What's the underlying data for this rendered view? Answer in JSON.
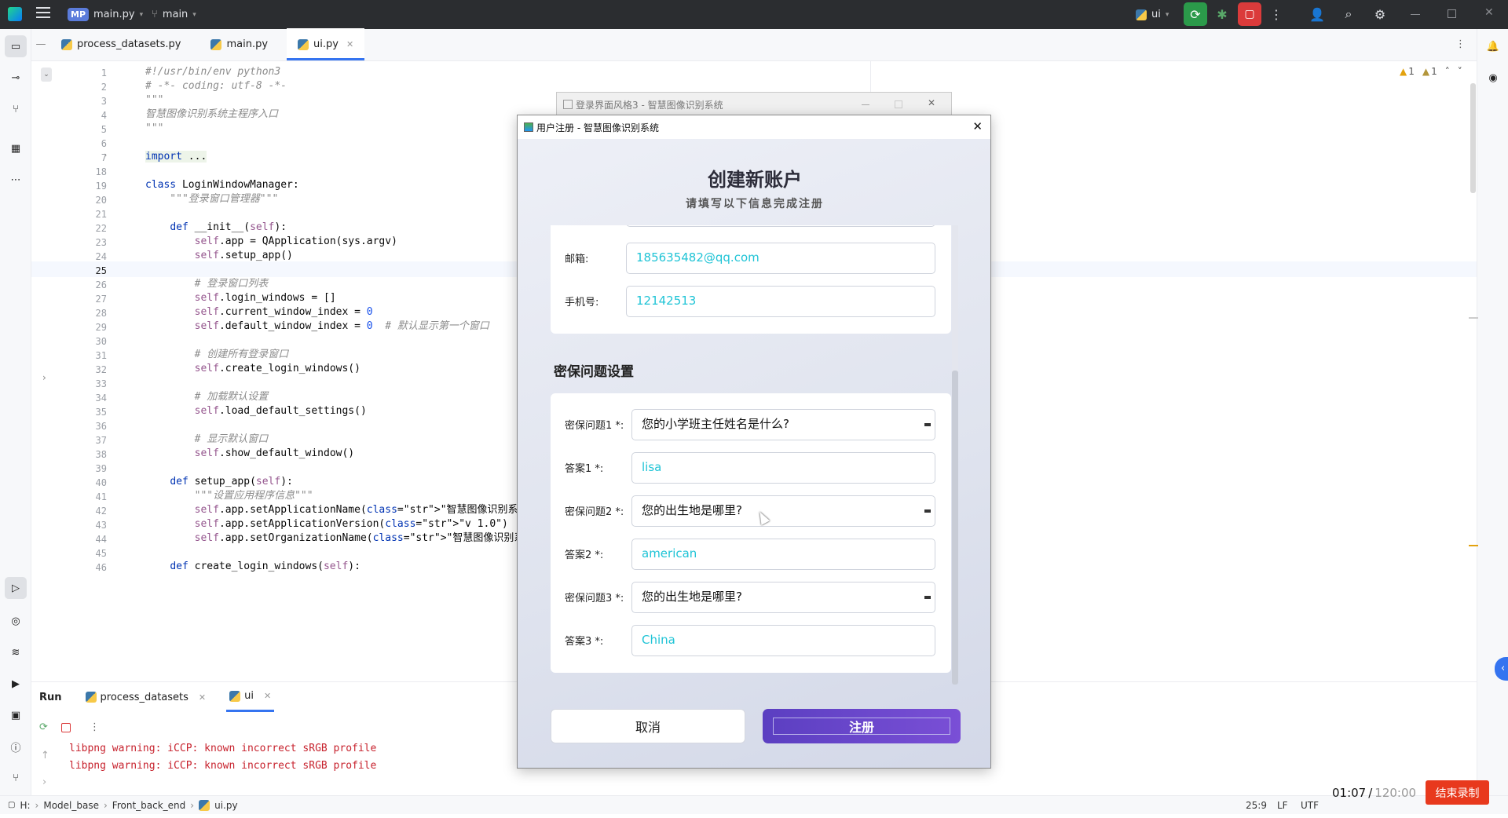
{
  "topbar": {
    "project_badge": "MP",
    "project": "main.py",
    "branch": "main",
    "run_config": "ui"
  },
  "tabs": [
    {
      "label": "process_datasets.py"
    },
    {
      "label": "main.py"
    },
    {
      "label": "ui.py"
    }
  ],
  "editor": {
    "inspections": {
      "warnings": "1",
      "weak_warnings": "1"
    },
    "line_numbers": [
      "1",
      "2",
      "3",
      "4",
      "5",
      "6",
      "7",
      "18",
      "19",
      "20",
      "21",
      "22",
      "23",
      "24",
      "25",
      "26",
      "27",
      "28",
      "29",
      "30",
      "31",
      "32",
      "33",
      "34",
      "35",
      "36",
      "37",
      "38",
      "39",
      "40",
      "41",
      "42",
      "43",
      "44",
      "45",
      "46"
    ],
    "lines": [
      "#!/usr/bin/env python3",
      "# -*- coding: utf-8 -*-",
      "\"\"\"",
      "智慧图像识别系统主程序入口",
      "\"\"\"",
      "",
      "import ...",
      "",
      "class LoginWindowManager:",
      "    \"\"\"登录窗口管理器\"\"\"",
      "",
      "    def __init__(self):",
      "        self.app = QApplication(sys.argv)",
      "        self.setup_app()",
      "",
      "        # 登录窗口列表",
      "        self.login_windows = []",
      "        self.current_window_index = 0",
      "        self.default_window_index = 0  # 默认显示第一个窗口",
      "",
      "        # 创建所有登录窗口",
      "        self.create_login_windows()",
      "",
      "        # 加载默认设置",
      "        self.load_default_settings()",
      "",
      "        # 显示默认窗口",
      "        self.show_default_window()",
      "",
      "    def setup_app(self):",
      "        \"\"\"设置应用程序信息\"\"\"",
      "        self.app.setApplicationName(\"智慧图像识别系统\")",
      "        self.app.setApplicationVersion(\"v 1.0\")",
      "        self.app.setOrganizationName(\"智慧图像识别系统\")",
      "",
      "    def create_login_windows(self):"
    ]
  },
  "run_panel": {
    "title": "Run",
    "tabs": [
      {
        "label": "process_datasets"
      },
      {
        "label": "ui"
      }
    ],
    "output": [
      "libpng warning: iCCP: known incorrect sRGB profile",
      "libpng warning: iCCP: known incorrect sRGB profile"
    ]
  },
  "statusbar": {
    "breadcrumb": [
      "H:",
      "Model_base",
      "Front_back_end",
      "ui.py"
    ],
    "position": "25:9",
    "line_sep": "LF",
    "encoding": "UTF"
  },
  "recorder": {
    "elapsed": "01:07",
    "separator": "/",
    "total": "120:00",
    "stop_label": "结束录制"
  },
  "bg_window": {
    "title": "登录界面风格3 - 智慧图像识别系统"
  },
  "dialog": {
    "title": "用户注册 - 智慧图像识别系统",
    "heading": "创建新账户",
    "subheading": "请填写以下信息完成注册",
    "email_label": "邮箱:",
    "email_value": "185635482@qq.com",
    "phone_label": "手机号:",
    "phone_value": "12142513",
    "security_heading": "密保问题设置",
    "questions": [
      {
        "q_label": "密保问题1 *:",
        "q_value": "您的小学班主任姓名是什么?",
        "a_label": "答案1 *:",
        "a_value": "lisa"
      },
      {
        "q_label": "密保问题2 *:",
        "q_value": "您的出生地是哪里?",
        "a_label": "答案2 *:",
        "a_value": "american"
      },
      {
        "q_label": "密保问题3 *:",
        "q_value": "您的出生地是哪里?",
        "a_label": "答案3 *:",
        "a_value": "China"
      }
    ],
    "cancel_label": "取消",
    "submit_label": "注册"
  }
}
